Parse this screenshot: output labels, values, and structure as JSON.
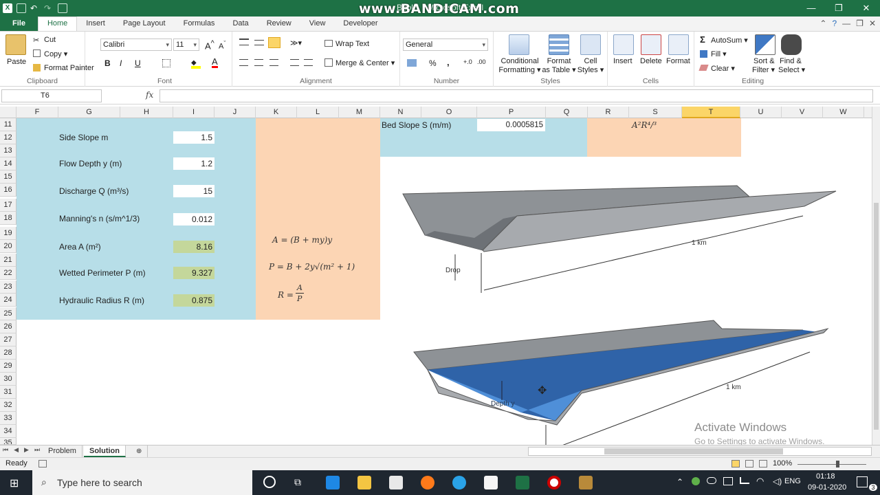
{
  "window": {
    "title": "Book1 - Microsoft Excel",
    "watermark": "www.BANDICAM.com",
    "controls": [
      "—",
      "❐",
      "✕"
    ]
  },
  "ribbon_tabs": [
    "File",
    "Home",
    "Insert",
    "Page Layout",
    "Formulas",
    "Data",
    "Review",
    "View",
    "Developer"
  ],
  "ribbon": {
    "clipboard": {
      "paste": "Paste",
      "cut": "Cut",
      "copy": "Copy ▾",
      "format_painter": "Format Painter",
      "label": "Clipboard"
    },
    "font": {
      "name": "Calibri",
      "size": "11",
      "label": "Font",
      "bold": "B",
      "italic": "I",
      "underline": "U"
    },
    "alignment": {
      "wrap_text": "Wrap Text",
      "merge_center": "Merge & Center ▾",
      "label": "Alignment"
    },
    "number": {
      "format": "General",
      "label": "Number",
      "percent": "%",
      "comma": ","
    },
    "styles": {
      "conditional": [
        "Conditional",
        "Formatting ▾"
      ],
      "format_table": [
        "Format",
        "as Table ▾"
      ],
      "cell_styles": [
        "Cell",
        "Styles ▾"
      ],
      "label": "Styles"
    },
    "cells": {
      "insert": "Insert",
      "delete": "Delete",
      "format": "Format",
      "label": "Cells"
    },
    "editing": {
      "autosum": "AutoSum ▾",
      "fill": "Fill ▾",
      "clear": "Clear ▾",
      "sort": [
        "Sort &",
        "Filter ▾"
      ],
      "find": [
        "Find &",
        "Select ▾"
      ],
      "label": "Editing"
    }
  },
  "formula_bar": {
    "name_box": "T6",
    "fx": "fx",
    "content": ""
  },
  "columns": [
    "F",
    "G",
    "H",
    "I",
    "J",
    "K",
    "L",
    "M",
    "N",
    "O",
    "P",
    "Q",
    "R",
    "S",
    "T",
    "U",
    "V",
    "W"
  ],
  "selected_column": "T",
  "rows": [
    "11",
    "12",
    "13",
    "14",
    "15",
    "16",
    "17",
    "18",
    "19",
    "20",
    "21",
    "22",
    "23",
    "24",
    "25",
    "26",
    "27",
    "28",
    "29",
    "30",
    "31",
    "32",
    "33",
    "34",
    "35"
  ],
  "parameters": [
    {
      "label": "Side Slope m",
      "value": "1.5",
      "computed": false
    },
    {
      "label": "Flow Depth y (m)",
      "value": "1.2",
      "computed": false
    },
    {
      "label": "Discharge Q (m³/s)",
      "value": "15",
      "computed": false
    },
    {
      "label": "Manning's n (s/m^1/3)",
      "value": "0.012",
      "computed": false
    },
    {
      "label": "Area A (m²)",
      "value": "8.16",
      "computed": true
    },
    {
      "label": "Wetted Perimeter P (m)",
      "value": "9.327",
      "computed": true
    },
    {
      "label": "Hydraulic Radius R (m)",
      "value": "0.875",
      "computed": true
    }
  ],
  "bed_slope": {
    "label": "Bed Slope S (m/m)",
    "value": "0.0005815"
  },
  "formulas": {
    "area": "A = (B + my)y",
    "perimeter": "P = B + 2y√(m² + 1)",
    "radius_lhs": "R =",
    "radius_num": "A",
    "radius_den": "P",
    "top_right": "A²R⁴/³"
  },
  "diagram": {
    "drop_label": "Drop",
    "length_label": "1 km",
    "depth_label": "Depth y"
  },
  "sheets": [
    "Problem",
    "Solution"
  ],
  "active_sheet": "Solution",
  "status": {
    "ready": "Ready",
    "zoom": "100%"
  },
  "activation": {
    "title": "Activate Windows",
    "subtitle": "Go to Settings to activate Windows."
  },
  "taskbar": {
    "search_placeholder": "Type here to search",
    "time": "01:18",
    "date": "09-01-2020",
    "lang": "ENG",
    "notifications": "3"
  },
  "colors": {
    "excel_green": "#1e7145",
    "input_panel": "#b7dee8",
    "formula_panel": "#fcd5b4",
    "computed_cell": "#c4d79b",
    "water": "#2f63a8"
  }
}
